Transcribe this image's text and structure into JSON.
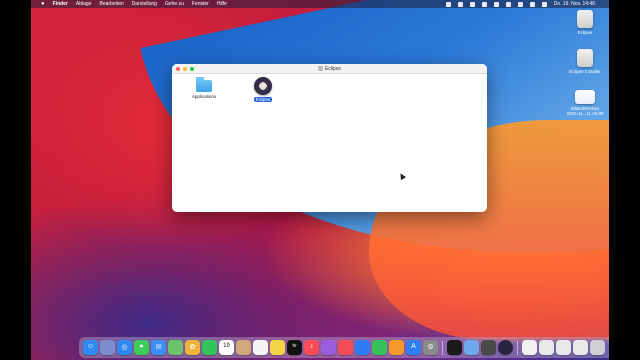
{
  "menubar": {
    "apple": "",
    "items": [
      "Finder",
      "Ablage",
      "Bearbeiten",
      "Darstellung",
      "Gehe zu",
      "Fenster",
      "Hilfe"
    ],
    "clock": "Do. 19. Nov. 14:46"
  },
  "desktop": {
    "icons": [
      {
        "label": "Eclipse"
      },
      {
        "label": "Eclipse Installer"
      },
      {
        "label_line1": "Bildschirmfoto",
        "label_line2": "2020-11...11.40.00"
      }
    ]
  },
  "window": {
    "title": "Eclipse",
    "items": [
      {
        "label": "Applications",
        "icon": "folder-icon",
        "selected": false
      },
      {
        "label": "Eclipse",
        "icon": "eclipse-app-icon",
        "selected": true
      }
    ]
  },
  "dock": {
    "apps": [
      {
        "name": "finder",
        "color": "#2e8cf0"
      },
      {
        "name": "launchpad",
        "color": "#7b8ccf"
      },
      {
        "name": "safari",
        "color": "#2f88ef"
      },
      {
        "name": "messages",
        "color": "#3dcc5a"
      },
      {
        "name": "mail",
        "color": "#3b8ff3"
      },
      {
        "name": "maps",
        "color": "#6bc36b"
      },
      {
        "name": "photos",
        "color": "#f0b43a"
      },
      {
        "name": "facetime",
        "color": "#33c45a"
      },
      {
        "name": "calendar",
        "color": "#ffffff"
      },
      {
        "name": "contacts",
        "color": "#d0a879"
      },
      {
        "name": "reminders",
        "color": "#f5f5f5"
      },
      {
        "name": "notes",
        "color": "#f7d54a"
      },
      {
        "name": "tv",
        "color": "#111111"
      },
      {
        "name": "music",
        "color": "#fa4b5a"
      },
      {
        "name": "podcasts",
        "color": "#9b5ce0"
      },
      {
        "name": "news",
        "color": "#f44c57"
      },
      {
        "name": "keynote",
        "color": "#2e7bf3"
      },
      {
        "name": "numbers",
        "color": "#34c25a"
      },
      {
        "name": "pages",
        "color": "#f39a2a"
      },
      {
        "name": "appstore",
        "color": "#2f7ff2"
      },
      {
        "name": "system-preferences",
        "color": "#8a8a8a"
      },
      {
        "name": "quicktime",
        "color": "#1a1a1a"
      },
      {
        "name": "preview",
        "color": "#6fa8e8"
      },
      {
        "name": "finalcut",
        "color": "#4a4a4a"
      },
      {
        "name": "eclipse",
        "color": "#2a2440"
      },
      {
        "name": "document-1",
        "color": "#f2f2f2"
      },
      {
        "name": "document-2",
        "color": "#e8e8e8"
      },
      {
        "name": "document-3",
        "color": "#e8e8e8"
      },
      {
        "name": "document-4",
        "color": "#e8e8e8"
      },
      {
        "name": "trash",
        "color": "#cfcfd6"
      }
    ],
    "calendar_day": "19",
    "tv_label": "tv"
  }
}
